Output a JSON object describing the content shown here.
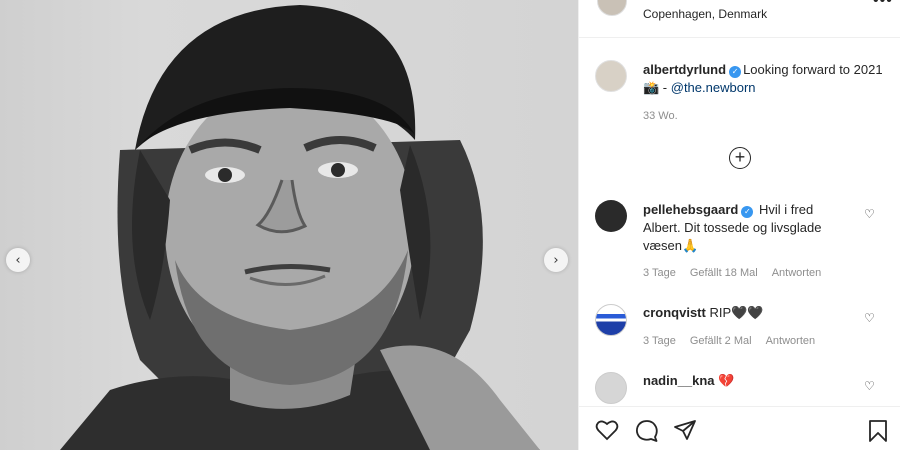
{
  "post": {
    "location": "Copenhagen, Denmark",
    "caption": {
      "username": "albertdyrlund",
      "text_before": "Looking forward to 2021 📸 - ",
      "mention": "@the.newborn",
      "time": "33 Wo."
    }
  },
  "comments": [
    {
      "username": "pellehebsgaard",
      "verified": true,
      "text": "Hvil i fred Albert. Dit tossede og livsglade væsen🙏",
      "time": "3 Tage",
      "likes": "Gefällt 18 Mal",
      "reply": "Antworten"
    },
    {
      "username": "cronqvistt",
      "verified": false,
      "text": "RIP🖤🖤",
      "time": "3 Tage",
      "likes": "Gefällt 2 Mal",
      "reply": "Antworten"
    },
    {
      "username": "nadin__kna",
      "verified": false,
      "text": "💔"
    }
  ],
  "icons": {
    "more": "more-options-icon",
    "load_more": "plus-circle-icon",
    "like": "heart-icon",
    "comment": "comment-icon",
    "share": "share-icon",
    "save": "bookmark-icon"
  },
  "colors": {
    "verified": "#3897f0",
    "mention": "#00376b",
    "meta": "#8e8e8e"
  }
}
